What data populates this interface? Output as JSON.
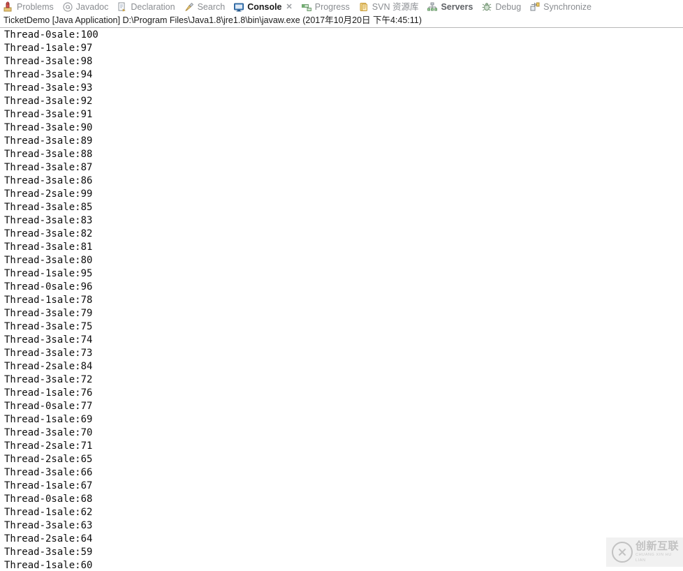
{
  "view_tabs": [
    {
      "label": "Problems",
      "icon": "problems-icon",
      "state": "inactive",
      "closable": false
    },
    {
      "label": "Javadoc",
      "icon": "javadoc-icon",
      "state": "inactive",
      "closable": false
    },
    {
      "label": "Declaration",
      "icon": "declaration-icon",
      "state": "inactive",
      "closable": false
    },
    {
      "label": "Search",
      "icon": "search-icon",
      "state": "inactive",
      "closable": false
    },
    {
      "label": "Console",
      "icon": "console-icon",
      "state": "active",
      "closable": true
    },
    {
      "label": "Progress",
      "icon": "progress-icon",
      "state": "inactive",
      "closable": false
    },
    {
      "label": "SVN 资源库",
      "icon": "svn-repository-icon",
      "state": "inactive",
      "closable": false
    },
    {
      "label": "Servers",
      "icon": "servers-icon",
      "state": "semi",
      "closable": false
    },
    {
      "label": "Debug",
      "icon": "debug-icon",
      "state": "inactive",
      "closable": false
    },
    {
      "label": "Synchronize",
      "icon": "synchronize-icon",
      "state": "inactive",
      "closable": false
    }
  ],
  "close_glyph": "✕",
  "launch": {
    "text": "TicketDemo [Java Application] D:\\Program Files\\Java1.8\\jre1.8\\bin\\javaw.exe (2017年10月20日 下午4:45:11)",
    "program": "TicketDemo",
    "type": "[Java Application]",
    "vm_path": "D:\\Program Files\\Java1.8\\jre1.8\\bin\\javaw.exe",
    "timestamp": "2017年10月20日 下午4:45:11"
  },
  "console": {
    "lines": [
      "Thread-0sale:100",
      "Thread-1sale:97",
      "Thread-3sale:98",
      "Thread-3sale:94",
      "Thread-3sale:93",
      "Thread-3sale:92",
      "Thread-3sale:91",
      "Thread-3sale:90",
      "Thread-3sale:89",
      "Thread-3sale:88",
      "Thread-3sale:87",
      "Thread-3sale:86",
      "Thread-2sale:99",
      "Thread-3sale:85",
      "Thread-3sale:83",
      "Thread-3sale:82",
      "Thread-3sale:81",
      "Thread-3sale:80",
      "Thread-1sale:95",
      "Thread-0sale:96",
      "Thread-1sale:78",
      "Thread-3sale:79",
      "Thread-3sale:75",
      "Thread-3sale:74",
      "Thread-3sale:73",
      "Thread-2sale:84",
      "Thread-3sale:72",
      "Thread-1sale:76",
      "Thread-0sale:77",
      "Thread-1sale:69",
      "Thread-3sale:70",
      "Thread-2sale:71",
      "Thread-2sale:65",
      "Thread-3sale:66",
      "Thread-1sale:67",
      "Thread-0sale:68",
      "Thread-1sale:62",
      "Thread-3sale:63",
      "Thread-2sale:64",
      "Thread-3sale:59",
      "Thread-1sale:60"
    ]
  },
  "watermark": {
    "mark": "cx-logo-icon",
    "chinese": "创新互联",
    "pinyin": "CHUANG XIN HU LIAN"
  },
  "colors": {
    "console_text": "#0d0d0d",
    "tab_inactive": "#8a8d91",
    "tab_active": "#1a1a1a",
    "separator": "#b8b8b8",
    "watermark_bg": "#f1f1f1"
  }
}
